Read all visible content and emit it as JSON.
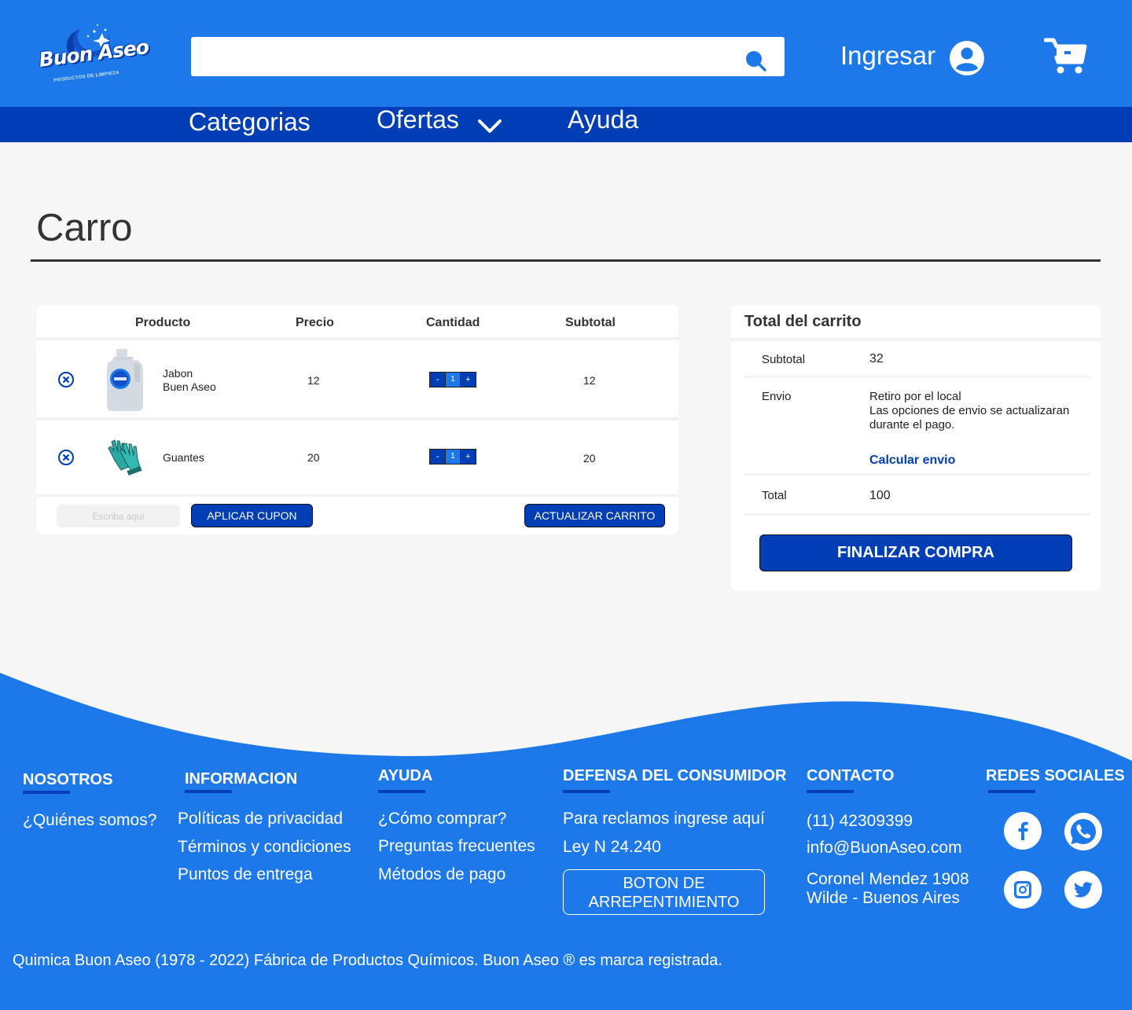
{
  "brand": {
    "name": "Buon Aseo",
    "tagline": "PRODUCTOS DE LIMPIEZA"
  },
  "header": {
    "search": {
      "value": "",
      "placeholder": ""
    },
    "login_label": "Ingresar"
  },
  "nav": {
    "items": [
      "Categorias",
      "Ofertas",
      "Ayuda"
    ]
  },
  "page": {
    "title": "Carro"
  },
  "cart": {
    "columns": [
      "Producto",
      "Precio",
      "Cantidad",
      "Subtotal"
    ],
    "items": [
      {
        "name_line1": "Jabon",
        "name_line2": "Buen Aseo",
        "price": "12",
        "quantity": "1",
        "subtotal": "12",
        "image": "detergent-bottle-icon"
      },
      {
        "name_line1": "Guantes",
        "name_line2": "",
        "price": "20",
        "quantity": "1",
        "subtotal": "20",
        "image": "gloves-icon"
      }
    ],
    "stepper": {
      "minus": "-",
      "plus": "+"
    },
    "coupon_placeholder": "Escriba aqui",
    "apply_coupon": "APLICAR CUPON",
    "update_cart": "ACTUALIZAR CARRITO"
  },
  "totals": {
    "title": "Total del carrito",
    "subtotal_label": "Subtotal",
    "subtotal_value": "32",
    "shipping_label": "Envio",
    "shipping_line1": "Retiro por el local",
    "shipping_line2": "Las opciones de envio se actualizaran",
    "shipping_line3": "durante el pago.",
    "calc_shipping": "Calcular envio",
    "total_label": "Total",
    "total_value": "100",
    "checkout": "FINALIZAR COMPRA"
  },
  "footer": {
    "nosotros": {
      "title": "NOSOTROS",
      "links": [
        "¿Quiénes somos?"
      ]
    },
    "informacion": {
      "title": "INFORMACION",
      "links": [
        "Políticas de privacidad",
        "Términos y condiciones",
        "Puntos de entrega"
      ]
    },
    "ayuda": {
      "title": "AYUDA",
      "links": [
        "¿Cómo comprar?",
        "Preguntas frecuentes",
        "Métodos de pago"
      ]
    },
    "defensa": {
      "title": "DEFENSA DEL CONSUMIDOR",
      "links": [
        "Para reclamos ingrese aquí",
        "Ley N 24.240"
      ],
      "button_line1": "BOTON DE",
      "button_line2": "ARREPENTIMIENTO"
    },
    "contacto": {
      "title": "CONTACTO",
      "phone": "(11) 42309399",
      "email": "info@BuonAseo.com",
      "address_line1": "Coronel Mendez 1908",
      "address_line2": "Wilde - Buenos Aires"
    },
    "redes": {
      "title": "REDES SOCIALES",
      "icons": [
        "facebook-icon",
        "whatsapp-icon",
        "instagram-icon",
        "twitter-icon"
      ]
    },
    "copyright": "Quimica Buon Aseo (1978 - 2022) Fábrica de Productos Químicos. Buon Aseo ® es marca registrada."
  },
  "colors": {
    "primary": "#1d79ea",
    "dark": "#003eb5",
    "background": "#f7f7f7"
  }
}
